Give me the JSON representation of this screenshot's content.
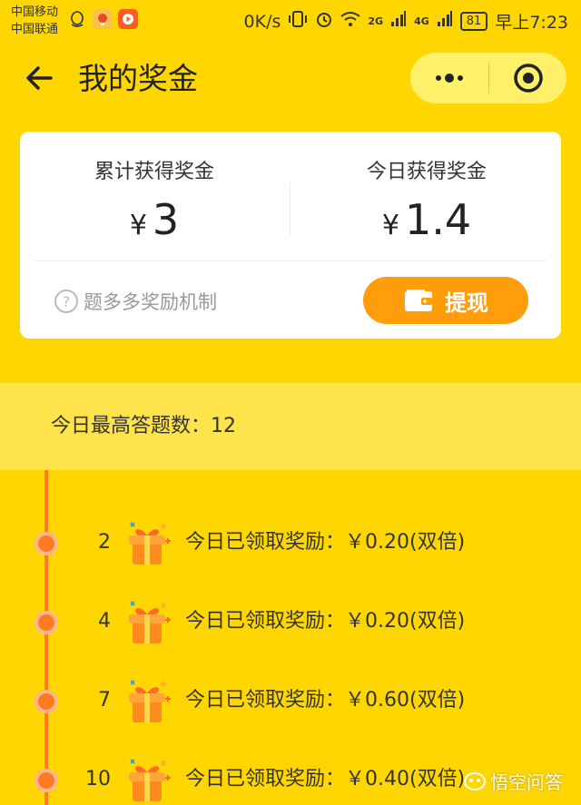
{
  "statusbar": {
    "carrier1": "中国移动",
    "carrier2": "中国联通",
    "speed": "0K/s",
    "signal1": "2G",
    "signal2": "4G",
    "battery": "81",
    "time": "早上7:23"
  },
  "nav": {
    "title": "我的奖金"
  },
  "summary": {
    "total_label": "累计获得奖金",
    "total_currency": "¥",
    "total_value": "3",
    "today_label": "今日获得奖金",
    "today_currency": "¥",
    "today_value": "1.4",
    "rules_link": "题多多奖励机制",
    "withdraw_label": "提现"
  },
  "max_answered": "今日最高答题数：12",
  "rewards": [
    {
      "count": "2",
      "text": "今日已领取奖励：￥0.20(双倍)"
    },
    {
      "count": "4",
      "text": "今日已领取奖励：￥0.20(双倍)"
    },
    {
      "count": "7",
      "text": "今日已领取奖励：￥0.60(双倍)"
    },
    {
      "count": "10",
      "text": "今日已领取奖励：￥0.40(双倍)"
    }
  ],
  "watermark": "悟空问答",
  "colors": {
    "background": "#FFD600",
    "accent_orange": "#FF9D0A",
    "timeline": "#FF7A22"
  }
}
